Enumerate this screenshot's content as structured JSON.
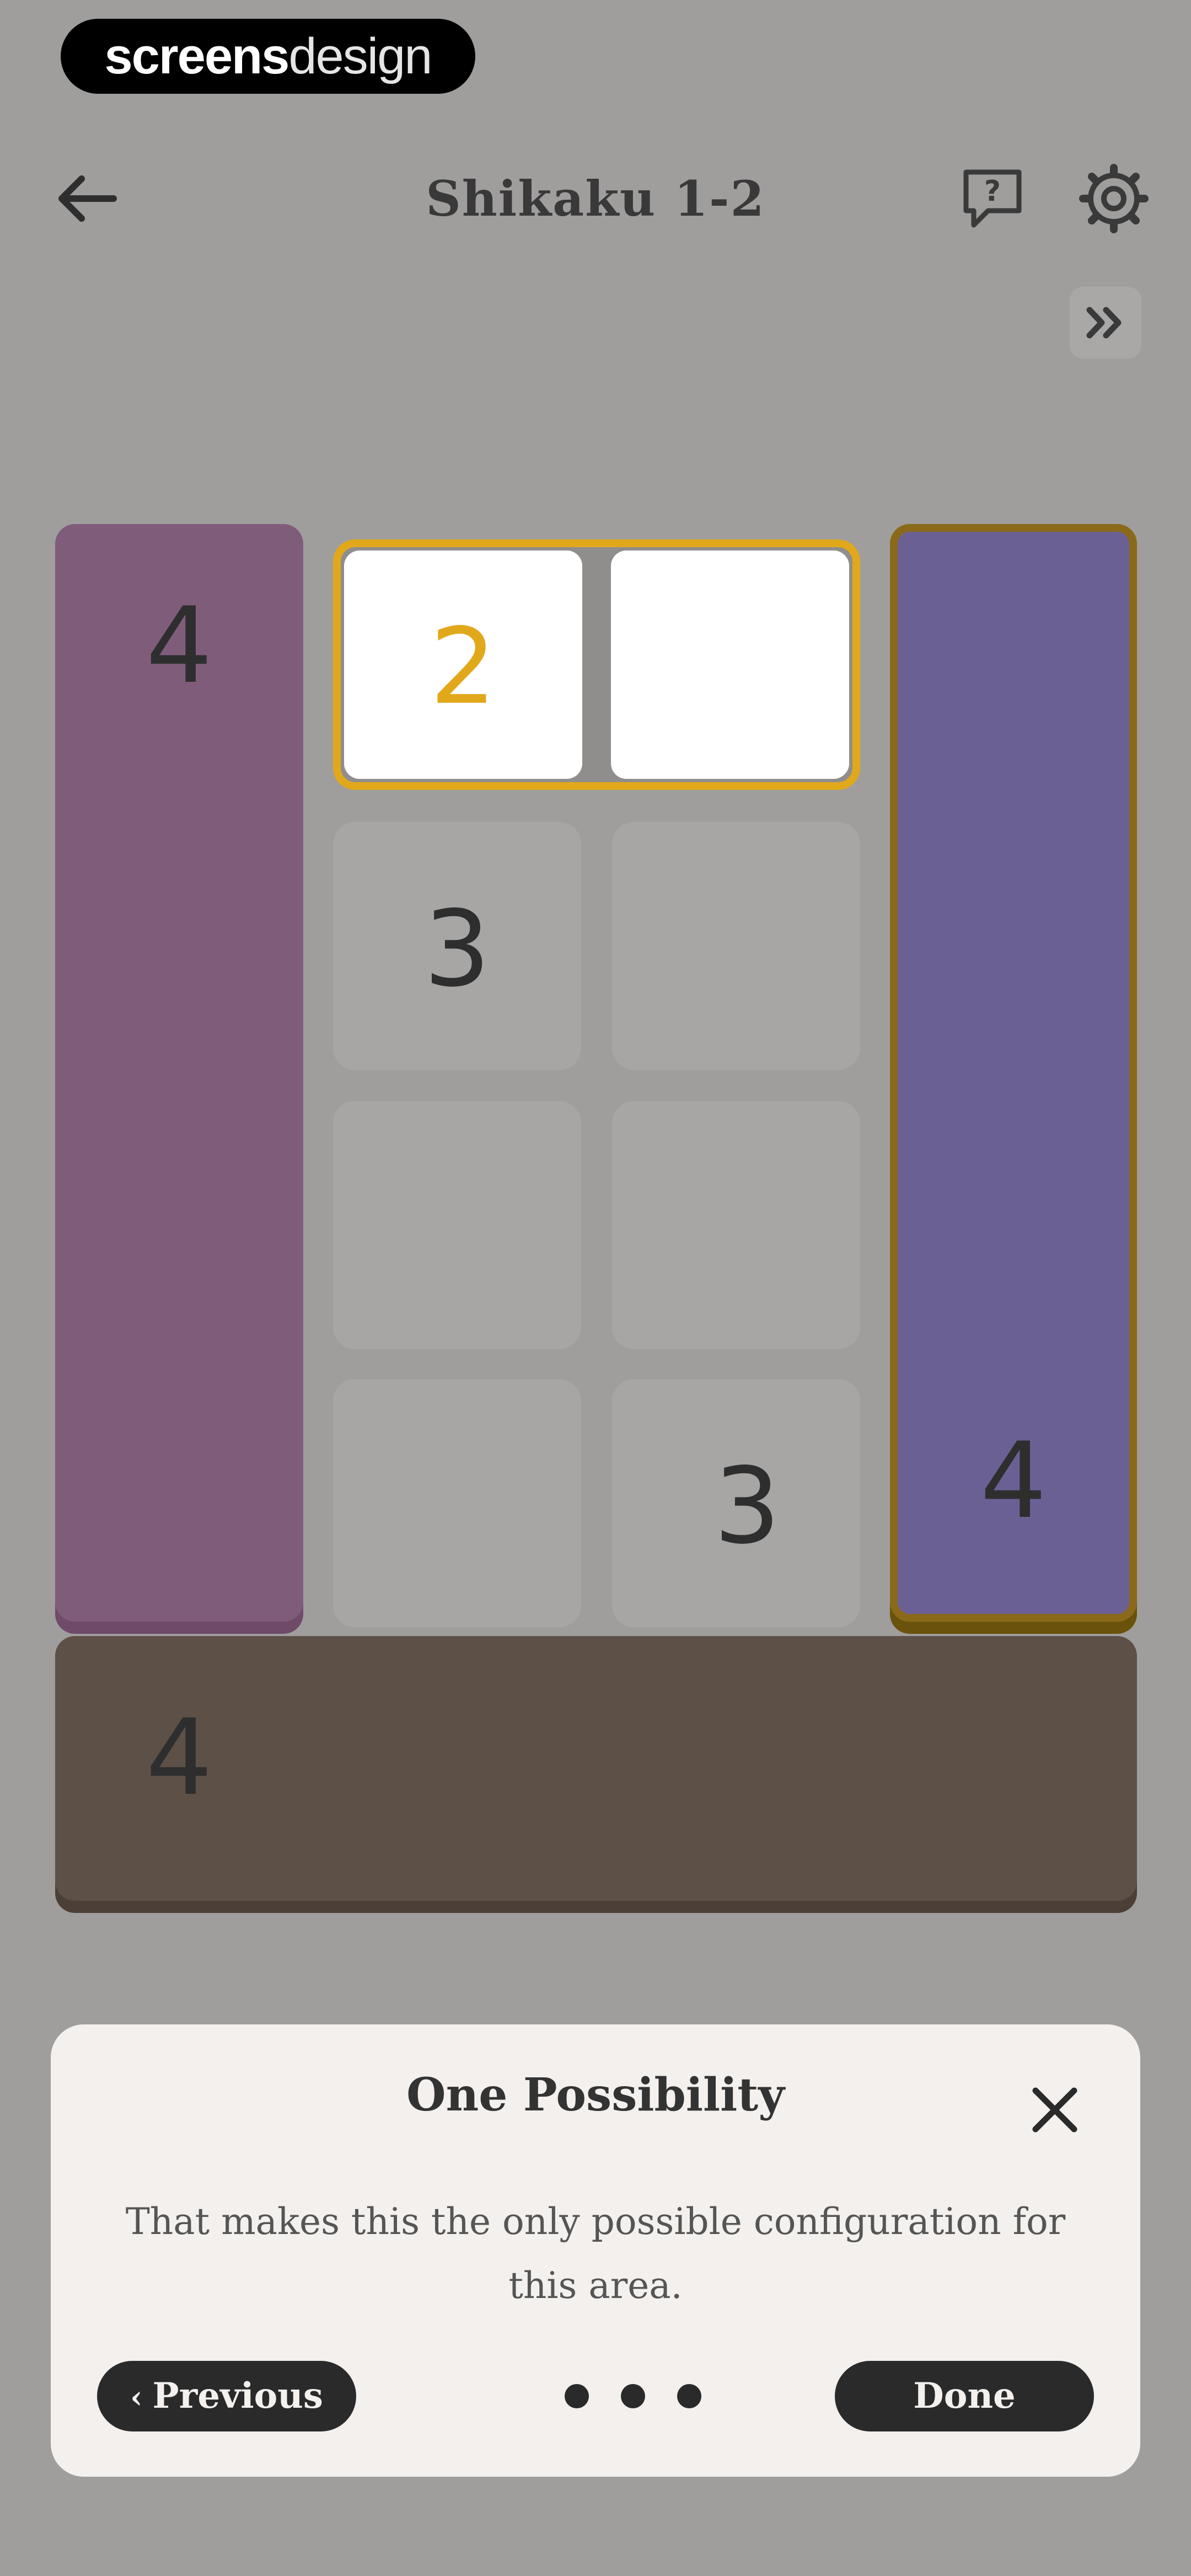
{
  "watermark": {
    "bold": "screens",
    "light": "design"
  },
  "header": {
    "title": "Shikaku 1-2",
    "back_icon": "arrow-left-icon",
    "help_icon": "help-bubble-icon",
    "settings_icon": "gear-icon",
    "skip_icon": "double-chevron-right-icon"
  },
  "board": {
    "left_region_number": "4",
    "top_cell_number": "2",
    "cell_3_a": "3",
    "cell_3_b": "3",
    "right_region_number": "4",
    "bottom_region_number": "4",
    "colors": {
      "left_region": "#805c7b",
      "right_region": "#6b6094",
      "bottom_region": "#5d5047",
      "highlight": "#e2a81b"
    }
  },
  "tooltip": {
    "title": "One Possibility",
    "body": "That makes this the only possible configuration for this area.",
    "previous_label": "Previous",
    "done_label": "Done",
    "page_dots": 3
  }
}
